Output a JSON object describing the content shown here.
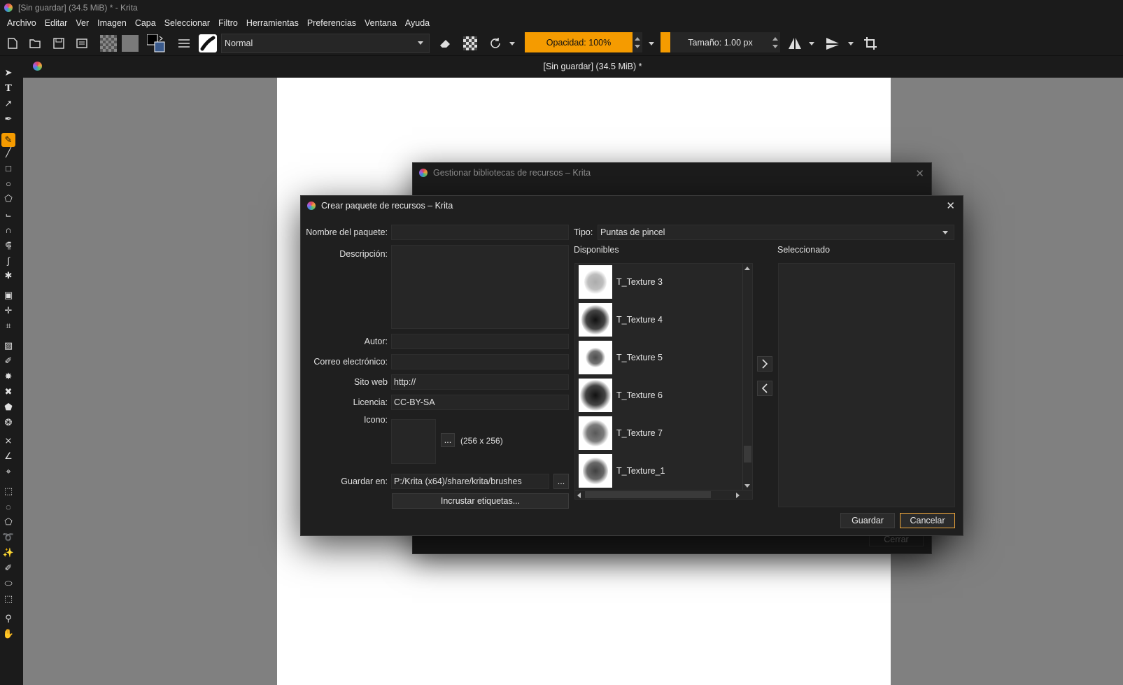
{
  "window": {
    "title": "[Sin guardar]  (34.5 MiB) * - Krita"
  },
  "menubar": [
    "Archivo",
    "Editar",
    "Ver",
    "Imagen",
    "Capa",
    "Seleccionar",
    "Filtro",
    "Herramientas",
    "Preferencias",
    "Ventana",
    "Ayuda"
  ],
  "toolbar": {
    "blend_mode": "Normal",
    "opacity": "Opacidad: 100%",
    "size": "Tamaño: 1.00 px",
    "accent": "#f59b00"
  },
  "document_tab": {
    "title": "[Sin guardar]  (34.5 MiB) *"
  },
  "back_dialog": {
    "title": "Gestionar bibliotecas de recursos – Krita",
    "close_label": "Cerrar"
  },
  "dialog": {
    "title": "Crear paquete de recursos – Krita",
    "labels": {
      "package_name": "Nombre del paquete:",
      "description": "Descripción:",
      "author": "Autor:",
      "email": "Correo electrónico:",
      "website": "Sito web",
      "license": "Licencia:",
      "icon": "Icono:",
      "save_to": "Guardar en:",
      "type": "Tipo:",
      "available": "Disponibles",
      "selected": "Seleccionado"
    },
    "values": {
      "package_name": "",
      "description": "",
      "author": "",
      "email": "",
      "website": "http://",
      "license": "CC-BY-SA",
      "icon_size": "(256 x 256)",
      "save_to": "P:/Krita (x64)/share/krita/brushes",
      "type": "Puntas de pincel"
    },
    "browse_label": "...",
    "embed_tags_label": "Incrustar etiquetas...",
    "available_items": [
      "T_Texture 3",
      "T_Texture 4",
      "T_Texture 5",
      "T_Texture 6",
      "T_Texture 7",
      "T_Texture_1"
    ],
    "save_label": "Guardar",
    "cancel_label": "Cancelar"
  }
}
